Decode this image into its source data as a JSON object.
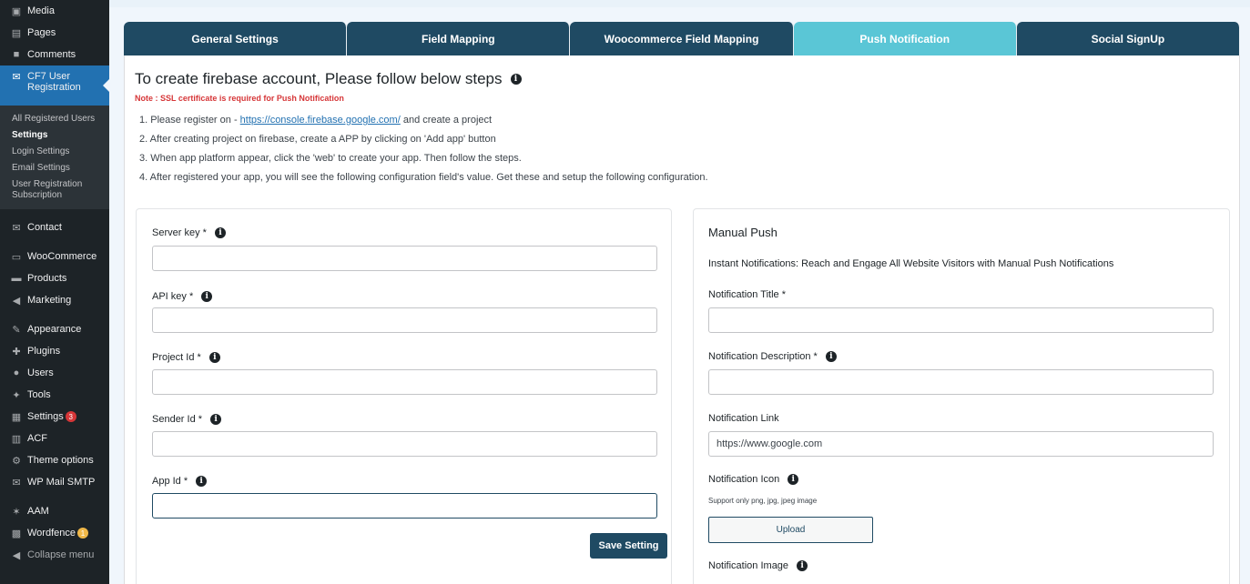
{
  "sidebar": {
    "top_items": [
      {
        "label": "Media",
        "icon": "media-icon"
      },
      {
        "label": "Pages",
        "icon": "pages-icon"
      },
      {
        "label": "Comments",
        "icon": "comments-icon"
      }
    ],
    "active_item": {
      "label_line1": "CF7 User",
      "label_line2": "Registration",
      "icon": "cf7-icon"
    },
    "submenu": [
      {
        "label": "All Registered Users"
      },
      {
        "label": "Settings"
      },
      {
        "label": "Login Settings"
      },
      {
        "label": "Email Settings"
      },
      {
        "label": "User Registration Subscription"
      }
    ],
    "items": [
      {
        "label": "Contact",
        "icon": "contact-icon"
      },
      {
        "label": "WooCommerce",
        "icon": "woocommerce-icon"
      },
      {
        "label": "Products",
        "icon": "products-icon"
      },
      {
        "label": "Marketing",
        "icon": "marketing-icon"
      },
      {
        "label": "Appearance",
        "icon": "appearance-icon"
      },
      {
        "label": "Plugins",
        "icon": "plugins-icon"
      },
      {
        "label": "Users",
        "icon": "users-icon"
      },
      {
        "label": "Tools",
        "icon": "tools-icon"
      },
      {
        "label": "Settings",
        "icon": "settings-icon",
        "badge": "3"
      },
      {
        "label": "ACF",
        "icon": "acf-icon"
      },
      {
        "label": "Theme options",
        "icon": "theme-options-icon"
      },
      {
        "label": "WP Mail SMTP",
        "icon": "mail-icon"
      },
      {
        "label": "AAM",
        "icon": "aam-icon"
      },
      {
        "label": "Wordfence",
        "icon": "wordfence-icon",
        "badge": "1"
      },
      {
        "label": "Collapse menu",
        "icon": "collapse-icon"
      }
    ]
  },
  "tabs": [
    {
      "label": "General Settings"
    },
    {
      "label": "Field Mapping"
    },
    {
      "label": "Woocommerce Field Mapping"
    },
    {
      "label": "Push Notification",
      "active": true
    },
    {
      "label": "Social SignUp"
    }
  ],
  "main": {
    "heading": "To create firebase account, Please follow below steps",
    "note": "Note : SSL certificate is required for Push Notification",
    "step1_prefix": "1. Please register on - ",
    "step1_link": "https://console.firebase.google.com/",
    "step1_suffix": " and create a project",
    "step2": "2. After creating project on firebase, create a APP by clicking on 'Add app' button",
    "step3": "3. When app platform appear, click the 'web' to create your app. Then follow the steps.",
    "step4": "4. After registered your app, you will see the following configuration field's value. Get these and setup the following configuration."
  },
  "config_form": {
    "server_key_label": "Server key *",
    "api_key_label": "API key *",
    "project_id_label": "Project Id *",
    "sender_id_label": "Sender Id *",
    "app_id_label": "App Id *",
    "save_label": "Save Setting"
  },
  "manual_push": {
    "title": "Manual Push",
    "description": "Instant Notifications: Reach and Engage All Website Visitors with Manual Push Notifications",
    "notif_title_label": "Notification Title *",
    "notif_desc_label": "Notification Description *",
    "notif_link_label": "Notification Link",
    "notif_link_value": "https://www.google.com",
    "notif_icon_label": "Notification Icon",
    "support_text": "Support only png, jpg, jpeg image",
    "upload_label": "Upload",
    "notif_image_label": "Notification Image"
  },
  "colors": {
    "sidebar_bg": "#1d2327",
    "sidebar_active": "#2271b1",
    "tab_bg": "#1f4a63",
    "tab_active": "#5ac6d6",
    "note_red": "#d63638"
  }
}
